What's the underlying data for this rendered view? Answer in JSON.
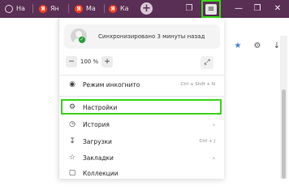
{
  "tabs": [
    {
      "label": "На",
      "icon": "web-icon"
    },
    {
      "label": "Ян",
      "icon": "yandex-icon"
    },
    {
      "label": "Ма",
      "icon": "yandex-icon"
    },
    {
      "label": "Ка",
      "icon": "yandex-icon"
    }
  ],
  "yandex_glyph": "Я",
  "titlebar": {
    "new_tab": "+",
    "menu_glyph": "≡",
    "minimize": "—",
    "restore": "❐",
    "close": "✕"
  },
  "sync": {
    "text": "Синхронизировано 3 минуты назад"
  },
  "zoom": {
    "minus": "−",
    "value": "100 %",
    "plus": "+"
  },
  "menu": {
    "incognito": {
      "label": "Режим инкогнито",
      "hotkey": "Ctrl + Shift + N"
    },
    "settings": {
      "label": "Настройки"
    },
    "history": {
      "label": "История"
    },
    "downloads": {
      "label": "Загрузки",
      "hotkey": "Ctrl + J"
    },
    "bookmarks": {
      "label": "Закладки"
    },
    "collections": {
      "label": "Коллекции"
    }
  },
  "colors": {
    "titlebar": "#5a2f55",
    "highlight": "#39d617",
    "yandex": "#fc3f1d",
    "sync_check": "#21a038"
  }
}
